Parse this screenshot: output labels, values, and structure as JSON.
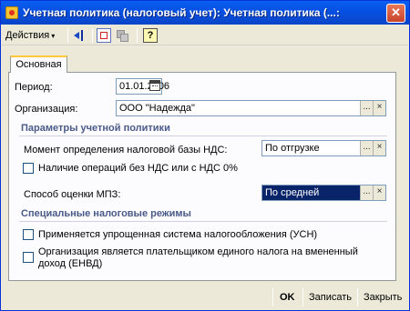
{
  "window": {
    "title": "Учетная политика (налоговый учет): Учетная политика (...: ",
    "close_glyph": "✕"
  },
  "toolbar": {
    "actions_label": "Действия",
    "actions_arrow": "▾",
    "help_glyph": "?"
  },
  "tabs": [
    {
      "label": "Основная"
    }
  ],
  "form": {
    "period_label": "Период:",
    "period_value": "01.01.2006",
    "org_label": "Организация:",
    "org_value": "ООО \"Надежда\"",
    "ellipsis": "...",
    "clear": "×",
    "group1_title": "Параметры учетной политики",
    "nds_moment_label": "Момент определения налоговой базы НДС:",
    "nds_moment_value": "По отгрузке",
    "no_nds_ops_label": "Наличие операций без НДС или с НДС 0%",
    "mpz_label": "Способ оценки МПЗ:",
    "mpz_value": "По средней",
    "group2_title": "Специальные налоговые режимы",
    "usn_label": "Применяется упрощенная система налогообложения (УСН)",
    "envd_label_line1": "Организация является плательщиком единого налога на вмененный",
    "envd_label_line2": "доход (ЕНВД)"
  },
  "footer": {
    "ok_label": "OK",
    "save_label": "Записать",
    "close_label": "Закрыть"
  }
}
